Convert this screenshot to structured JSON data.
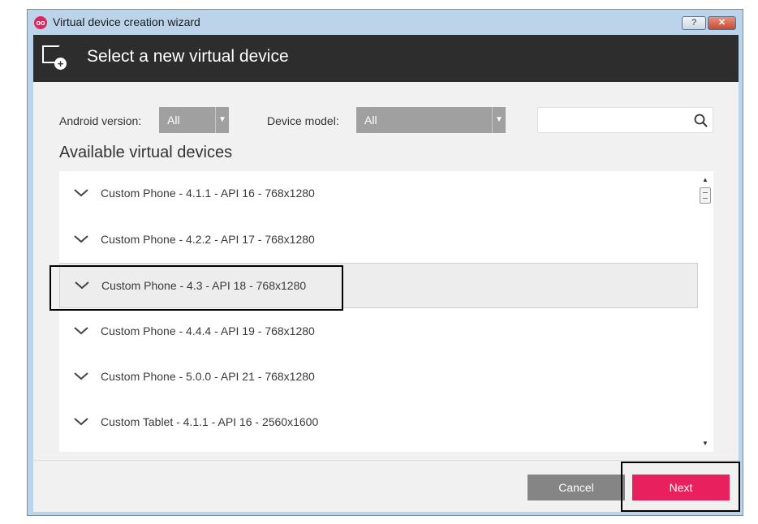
{
  "window": {
    "title": "Virtual device creation wizard",
    "help_label": "?",
    "close_label": "✕"
  },
  "header": {
    "title": "Select a new virtual device",
    "icon": "add-device-icon"
  },
  "filters": {
    "android_version_label": "Android version:",
    "android_version_value": "All",
    "device_model_label": "Device model:",
    "device_model_value": "All",
    "search_placeholder": ""
  },
  "list": {
    "title": "Available virtual devices",
    "items": [
      {
        "label": "Custom Phone - 4.1.1 - API 16 - 768x1280"
      },
      {
        "label": "Custom Phone - 4.2.2 - API 17 - 768x1280"
      },
      {
        "label": "Custom Phone - 4.3 - API 18 - 768x1280",
        "selected": true
      },
      {
        "label": "Custom Phone - 4.4.4 - API 19 - 768x1280"
      },
      {
        "label": "Custom Phone - 5.0.0 - API 21 - 768x1280"
      },
      {
        "label": "Custom Tablet - 4.1.1 - API 16 - 2560x1600"
      }
    ]
  },
  "footer": {
    "cancel_label": "Cancel",
    "next_label": "Next"
  },
  "colors": {
    "accent": "#e8215e",
    "header_bg": "#2d2d2d",
    "dropdown_bg": "#a0a0a0"
  }
}
